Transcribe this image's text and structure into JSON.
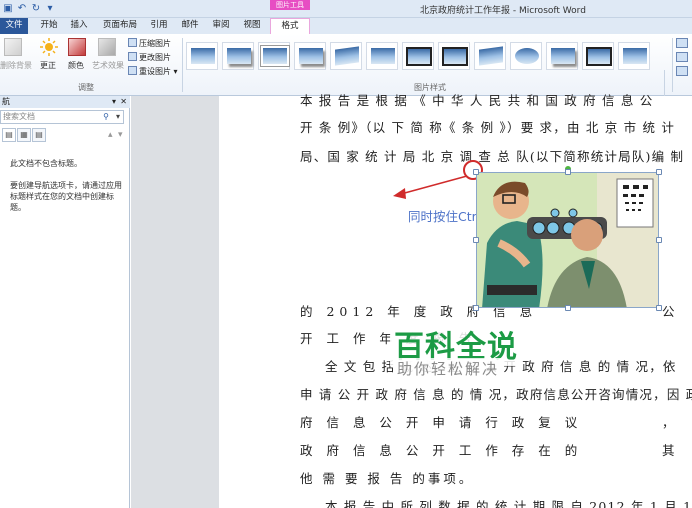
{
  "window": {
    "title": "北京政府统计工作年报 - Microsoft Word",
    "context_tab_header": "图片工具"
  },
  "tabs": [
    {
      "label": "文件",
      "active": false
    },
    {
      "label": "开始",
      "active": false
    },
    {
      "label": "插入",
      "active": false
    },
    {
      "label": "页面布局",
      "active": false
    },
    {
      "label": "引用",
      "active": false
    },
    {
      "label": "邮件",
      "active": false
    },
    {
      "label": "审阅",
      "active": false
    },
    {
      "label": "视图",
      "active": false
    },
    {
      "label": "格式",
      "active": true
    }
  ],
  "ribbon": {
    "adjust": {
      "remove_bg": "删除背景",
      "corrections": "更正",
      "color": "颜色",
      "artistic": "艺术效果",
      "compress": "压缩图片",
      "change": "更改图片",
      "reset": "重设图片",
      "group_label": "调整"
    },
    "styles_group_label": "图片样式",
    "gallery_count": 13
  },
  "nav_pane": {
    "title": "航",
    "search_placeholder": "搜索文档",
    "msg_no_headings": "此文档不包含标题。",
    "msg_hint": "要创建导航选项卡，请通过应用标题样式在您的文档中创建标题。"
  },
  "document": {
    "lines": [
      "本 报 告 是 根 据 《 中 华 人 民 共 和 国 政 府 信 息 公",
      "开 条 例》（以 下 简 称《 条 例 》）要 求，由 北 京 市 统 计",
      "局、国 家 统 计 局 北 京 调 查 总 队(以下简称统计局队)编 制",
      "的 2012 年 度 政 府 信 息",
      "开 工 作 年 度 报 告。",
      "全 文 包 括 概 述，主 动 公 开 政 府 信 息 的 情 况，依",
      "申 请 公 开 政 府 信 息 的 情 况，政府信息公开咨询情况，因 政",
      "府 信 息 公 开 申 请 行 政 复 议",
      "政 府 信 息 公 开 工 作 存 在 的",
      "他 需 要 报 告 的事项。",
      "本 报 告 中 所 列 数 据 的 统 计 期 限 自 2012 年 1 月 1"
    ],
    "line3_tail": "公",
    "line8_tail": "，",
    "line9_tail": "其",
    "overlay_instruction": "同时按住Ctrl和shift"
  },
  "watermark": {
    "title": "百科全说",
    "subtitle": "助你轻松解决"
  },
  "colors": {
    "file_tab": "#2b579a",
    "context_tab": "#e74ec3",
    "annotation_red": "#d02b2b",
    "instruction_blue": "#4e73c8",
    "watermark_green": "#1c9b45"
  }
}
